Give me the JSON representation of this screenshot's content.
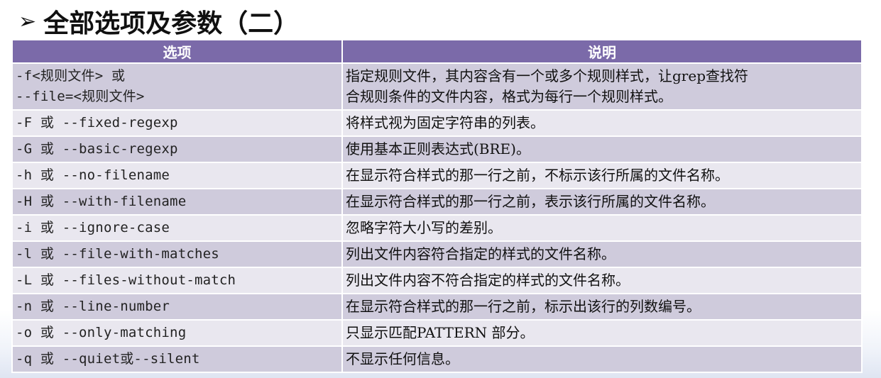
{
  "slide": {
    "bullet": "➢",
    "title": "全部选项及参数（二）"
  },
  "table": {
    "headers": [
      "选项",
      "说明"
    ],
    "rows": [
      {
        "option": [
          "-f<规则文件> 或",
          "--file=<规则文件>"
        ],
        "description": [
          "指定规则文件，其内容含有一个或多个规则样式，让grep查找符",
          "合规则条件的文件内容，格式为每行一个规则样式。"
        ]
      },
      {
        "option": [
          "-F 或 --fixed-regexp"
        ],
        "description": [
          "将样式视为固定字符串的列表。"
        ]
      },
      {
        "option": [
          "-G 或 --basic-regexp"
        ],
        "description": [
          "使用基本正则表达式(BRE)。"
        ]
      },
      {
        "option": [
          "-h 或 --no-filename"
        ],
        "description": [
          "在显示符合样式的那一行之前，不标示该行所属的文件名称。"
        ]
      },
      {
        "option": [
          "-H 或 --with-filename"
        ],
        "description": [
          "在显示符合样式的那一行之前，表示该行所属的文件名称。"
        ]
      },
      {
        "option": [
          "-i 或 --ignore-case"
        ],
        "description": [
          "忽略字符大小写的差别。"
        ]
      },
      {
        "option": [
          "-l 或 --file-with-matches"
        ],
        "description": [
          "列出文件内容符合指定的样式的文件名称。"
        ]
      },
      {
        "option": [
          "-L 或 --files-without-match"
        ],
        "description": [
          "列出文件内容不符合指定的样式的文件名称。"
        ]
      },
      {
        "option": [
          "-n 或 --line-number"
        ],
        "description": [
          "在显示符合样式的那一行之前，标示出该行的列数编号。"
        ]
      },
      {
        "option": [
          "-o 或 --only-matching"
        ],
        "description": [
          "只显示匹配PATTERN 部分。"
        ]
      },
      {
        "option": [
          "-q 或 --quiet或--silent"
        ],
        "description": [
          "不显示任何信息。"
        ]
      }
    ]
  }
}
